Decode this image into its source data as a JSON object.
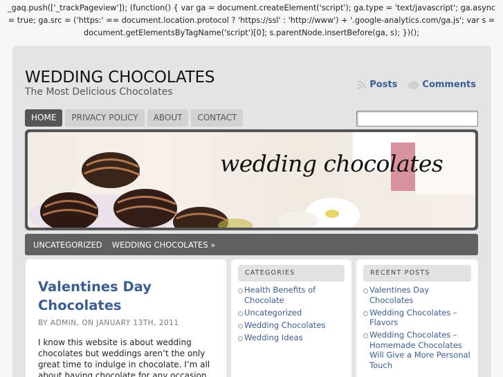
{
  "top_code": {
    "line1": "_gaq.push(['_trackPageview']); (function() { var ga = document.createElement('script'); ga.type = 'text/javascript'; ga.async",
    "line2": "= true; ga.src = ('https:' == document.location.protocol ? 'https://ssl' : 'http://www') + '.google-analytics.com/ga.js'; var s =",
    "line3": "document.getElementsByTagName('script')[0]; s.parentNode.insertBefore(ga, s); })();"
  },
  "site": {
    "title": "WEDDING CHOCOLATES",
    "tagline": "The Most Delicious Chocolates"
  },
  "feeds": {
    "posts": "Posts",
    "comments": "Comments"
  },
  "nav": {
    "items": [
      {
        "label": "HOME",
        "active": true
      },
      {
        "label": "PRIVACY POLICY"
      },
      {
        "label": "ABOUT"
      },
      {
        "label": "CONTACT"
      }
    ]
  },
  "search": {
    "value": ""
  },
  "banner": {
    "text": "wedding chocolates"
  },
  "category_bar": {
    "items": [
      {
        "label": "UNCATEGORIZED"
      },
      {
        "label": "WEDDING CHOCOLATES »"
      }
    ]
  },
  "post": {
    "title": "Valentines Day Chocolates",
    "meta": "BY ADMIN, ON JANUARY 13TH, 2011",
    "body": "I know this website is about wedding chocolates but weddings aren’t the only great time to indulge in chocolate. I’m all about having chocolate for any occasion."
  },
  "widgets": {
    "categories": {
      "title": "CATEGORIES",
      "items": [
        "Health Benefits of Chocolate",
        "Uncategorized",
        "Wedding Chocolates",
        "Wedding Ideas"
      ]
    },
    "recent": {
      "title": "RECENT POSTS",
      "items": [
        "Valentines Day Chocolates",
        "Wedding Chocolates – Flavors",
        "Wedding Chocolates – Homemade Chocolates Will Give a More Personal Touch"
      ]
    }
  },
  "colors": {
    "link": "#3a5e94",
    "nav_active": "#555555",
    "category_bar": "#616161"
  }
}
